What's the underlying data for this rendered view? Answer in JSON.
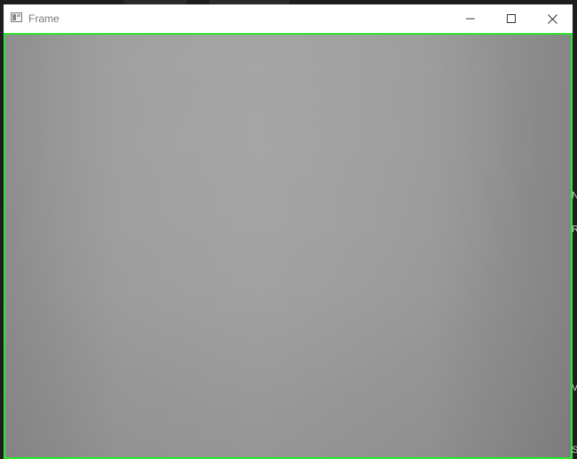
{
  "window": {
    "title": "Frame",
    "icon": "opencv-window-icon",
    "controls": {
      "minimize_icon": "minimize-icon",
      "maximize_icon": "maximize-icon",
      "close_icon": "close-icon"
    }
  },
  "frame": {
    "content": "camera-feed",
    "detection_box_color": "#2ee82e"
  },
  "background_window": {
    "edge_letters": [
      "N",
      "R",
      "V",
      "S"
    ]
  },
  "colors": {
    "titlebar": "#ffffff",
    "title_text": "#7a7a7a",
    "detection_box": "#2ee82e",
    "backdrop": "#1e1e1e"
  }
}
